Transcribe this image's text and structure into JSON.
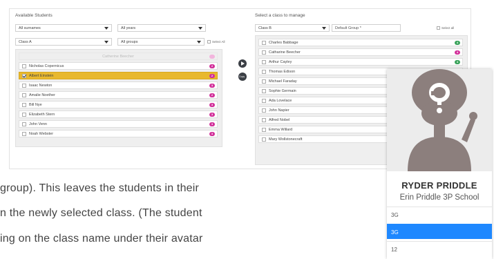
{
  "left_panel": {
    "title": "Available Students",
    "surname_filter": "All surnames",
    "year_filter": "All years",
    "class_filter": "Class A",
    "group_filter": "All groups",
    "select_all_label": "Select All",
    "disabled_student": "Catherine Beecher",
    "students": [
      {
        "name": "Nicholas Copernicus",
        "badge": "2",
        "selected": false
      },
      {
        "name": "Albert Einstein",
        "badge": "2",
        "selected": true
      },
      {
        "name": "Isaac Newton",
        "badge": "3",
        "selected": false
      },
      {
        "name": "Amalie Noether",
        "badge": "2",
        "selected": false
      },
      {
        "name": "Bill Nye",
        "badge": "3",
        "selected": false
      },
      {
        "name": "Elizabeth Stern",
        "badge": "3",
        "selected": false
      },
      {
        "name": "John Venn",
        "badge": "3",
        "selected": false
      },
      {
        "name": "Noah Webster",
        "badge": "3",
        "selected": false
      }
    ]
  },
  "copy_button_label": "Copy",
  "right_panel": {
    "title": "Select a class to manage",
    "class_select": "Class B",
    "group_input": "Default Group *",
    "select_all_label": "Select all",
    "students": [
      {
        "name": "Charles Babbage",
        "badge": "4",
        "badge_color": "#3aa35b"
      },
      {
        "name": "Catharine Beecher",
        "badge": "4",
        "badge_color": "#d2309a"
      },
      {
        "name": "Arthur Cayley",
        "badge": "4",
        "badge_color": "#3aa35b"
      },
      {
        "name": "Thomas Edison",
        "badge": "",
        "badge_color": ""
      },
      {
        "name": "Michael Faraday",
        "badge": "",
        "badge_color": ""
      },
      {
        "name": "Sophie Germain",
        "badge": "",
        "badge_color": ""
      },
      {
        "name": "Ada Lovelace",
        "badge": "",
        "badge_color": ""
      },
      {
        "name": "John Napier",
        "badge": "",
        "badge_color": ""
      },
      {
        "name": "Alfred Nobel",
        "badge": "",
        "badge_color": ""
      },
      {
        "name": "Emma Willard",
        "badge": "",
        "badge_color": ""
      },
      {
        "name": "Mary Wollstonecraft",
        "badge": "",
        "badge_color": ""
      }
    ]
  },
  "body_text": {
    "line1": "group). This leaves the students in their",
    "line2": "n the newly selected class. (The student",
    "line3": "ing on the class name under their avatar"
  },
  "profile_card": {
    "name": "RYDER PRIDDLE",
    "school": "Erin Priddle 3P School",
    "classes": [
      {
        "label": "3G",
        "active": false
      },
      {
        "label": "3G",
        "active": true
      },
      {
        "label": "12",
        "active": false
      }
    ]
  },
  "colors": {
    "badge_default": "#d2309a",
    "selected_row": "#e8b82e",
    "active_class": "#1e88ff"
  }
}
